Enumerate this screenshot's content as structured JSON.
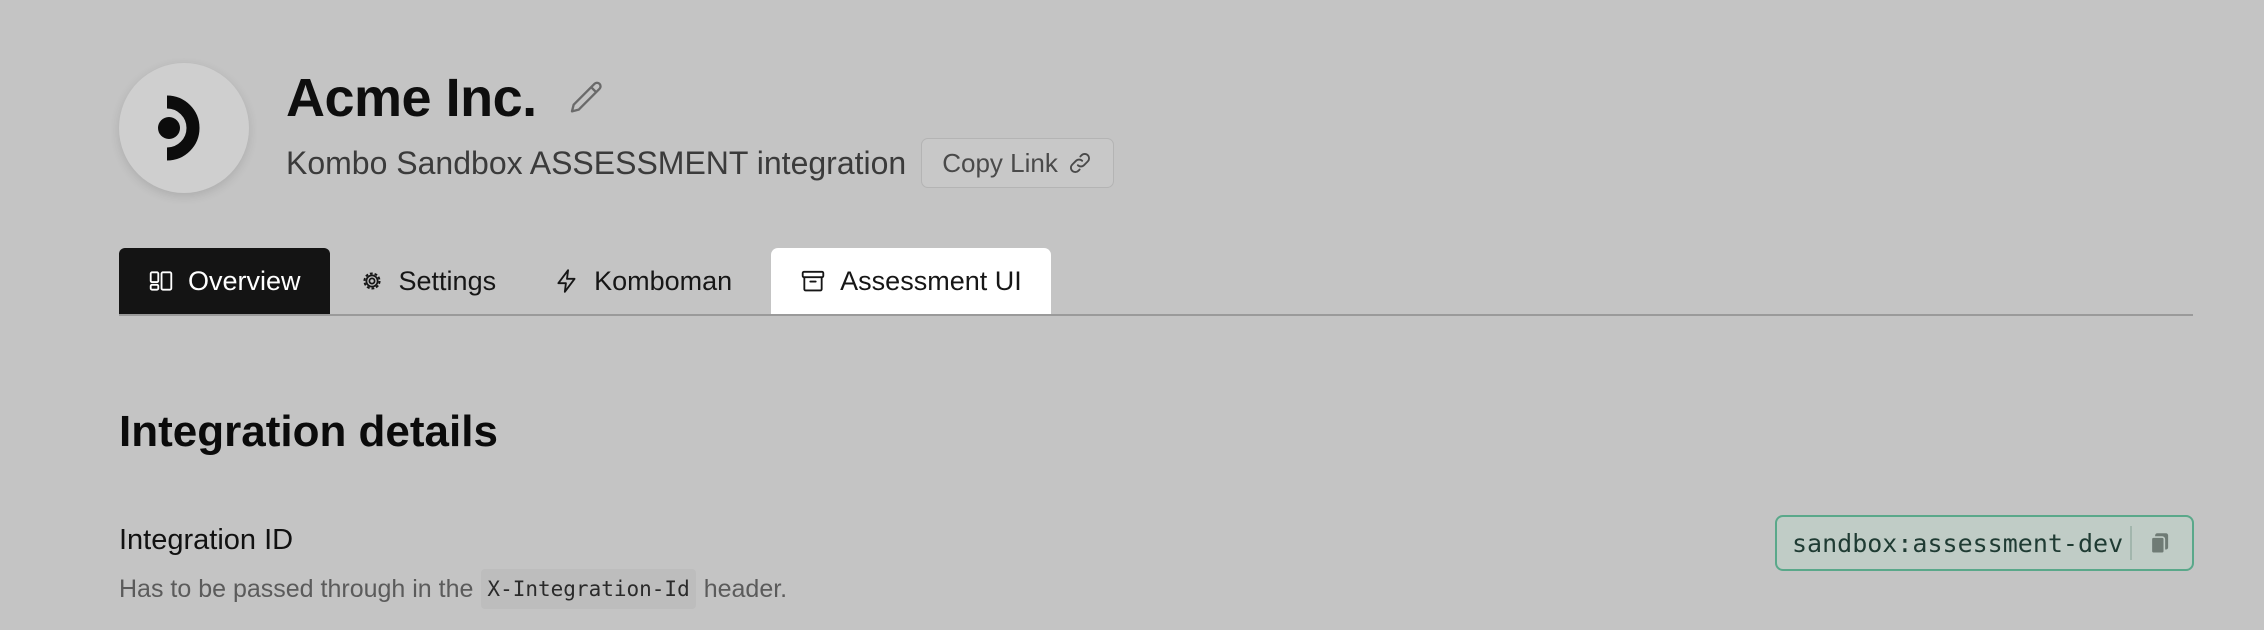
{
  "header": {
    "company_name": "Acme Inc.",
    "integration_name": "Kombo Sandbox ASSESSMENT integration",
    "copy_link_label": "Copy Link"
  },
  "tabs": [
    {
      "label": "Overview",
      "icon": "layout-icon",
      "active": true
    },
    {
      "label": "Settings",
      "icon": "gear-icon",
      "active": false
    },
    {
      "label": "Komboman",
      "icon": "lightning-icon",
      "active": false
    },
    {
      "label": "Assessment UI",
      "icon": "archive-icon",
      "active": false
    }
  ],
  "section": {
    "title": "Integration details"
  },
  "integration_id": {
    "label": "Integration ID",
    "desc_before": "Has to be passed through in the",
    "header_name": "X-Integration-Id",
    "desc_after": "header.",
    "value": "sandbox:assessment-dev"
  },
  "colors": {
    "background": "#c4c4c4",
    "active_tab": "#141414",
    "highlight_tab": "#ffffff",
    "chip_border": "#5aa88a"
  }
}
